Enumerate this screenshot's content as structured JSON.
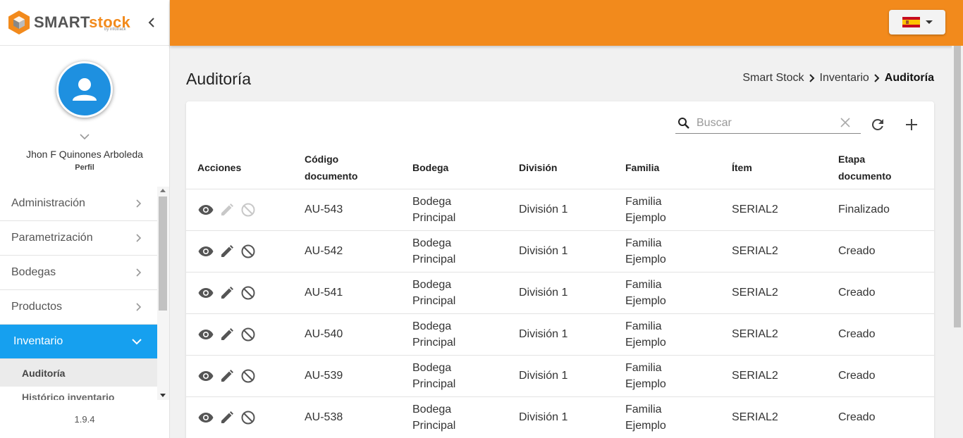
{
  "brand": {
    "name_part1": "SMART",
    "name_part2": "stock",
    "sub": "by infotrack"
  },
  "colors": {
    "topbar": "#f28a1c",
    "active_menu": "#16a0ef",
    "avatar": "#1e90e0"
  },
  "profile": {
    "name": "Jhon F Quinones Arboleda",
    "link": "Perfil"
  },
  "menu": {
    "items": [
      {
        "label": "Administración"
      },
      {
        "label": "Parametrización"
      },
      {
        "label": "Bodegas"
      },
      {
        "label": "Productos"
      },
      {
        "label": "Inventario"
      }
    ],
    "sub": [
      {
        "label": "Auditoría"
      },
      {
        "label": "Histórico inventario"
      }
    ]
  },
  "version": "1.9.4",
  "language": {
    "flag": "spain-flag-icon"
  },
  "page": {
    "title": "Auditoría"
  },
  "breadcrumb": {
    "b1": "Smart Stock",
    "b2": "Inventario",
    "b3": "Auditoría"
  },
  "search": {
    "placeholder": "Buscar",
    "value": ""
  },
  "table": {
    "headers": {
      "acciones": "Acciones",
      "codigo_1": "Código",
      "codigo_2": "documento",
      "bodega": "Bodega",
      "division": "División",
      "familia": "Familia",
      "item": "Ítem",
      "etapa_1": "Etapa",
      "etapa_2": "documento"
    },
    "rows": [
      {
        "codigo": "AU-543",
        "bodega_1": "Bodega",
        "bodega_2": "Principal",
        "division": "División 1",
        "familia_1": "Familia",
        "familia_2": "Ejemplo",
        "item": "SERIAL2",
        "etapa": "Finalizado"
      },
      {
        "codigo": "AU-542",
        "bodega_1": "Bodega",
        "bodega_2": "Principal",
        "division": "División 1",
        "familia_1": "Familia",
        "familia_2": "Ejemplo",
        "item": "SERIAL2",
        "etapa": "Creado"
      },
      {
        "codigo": "AU-541",
        "bodega_1": "Bodega",
        "bodega_2": "Principal",
        "division": "División 1",
        "familia_1": "Familia",
        "familia_2": "Ejemplo",
        "item": "SERIAL2",
        "etapa": "Creado"
      },
      {
        "codigo": "AU-540",
        "bodega_1": "Bodega",
        "bodega_2": "Principal",
        "division": "División 1",
        "familia_1": "Familia",
        "familia_2": "Ejemplo",
        "item": "SERIAL2",
        "etapa": "Creado"
      },
      {
        "codigo": "AU-539",
        "bodega_1": "Bodega",
        "bodega_2": "Principal",
        "division": "División 1",
        "familia_1": "Familia",
        "familia_2": "Ejemplo",
        "item": "SERIAL2",
        "etapa": "Creado"
      },
      {
        "codigo": "AU-538",
        "bodega_1": "Bodega",
        "bodega_2": "Principal",
        "division": "División 1",
        "familia_1": "Familia",
        "familia_2": "Ejemplo",
        "item": "SERIAL2",
        "etapa": "Creado"
      }
    ]
  }
}
